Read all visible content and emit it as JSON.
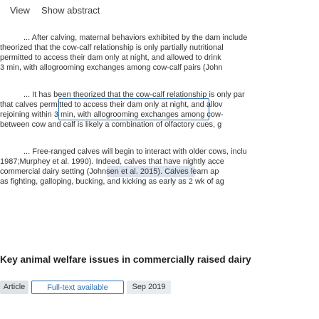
{
  "topbar": {
    "view_label": "View",
    "show_abstract_label": "Show abstract"
  },
  "paragraphs": [
    {
      "lines": [
        "... After calving, maternal behaviors exhibited by the dam include",
        "theorized that the cow-calf relationship is only partially nutritional",
        "permitted to access their dam only at night, and allowed to drink",
        "3 min, with allogrooming exchanges among cow-calf pairs (John"
      ]
    },
    {
      "lines": [
        "... It has been theorized that the cow-calf relationship is only par",
        "that calves permitted to access their dam only at night, and allov",
        "rejoining within 3 min, with allogrooming exchanges among cow-",
        "between cow and calf is likely a combination of olfactory cues, g"
      ]
    },
    {
      "lines": [
        "... Free-ranged calves will begin to interact with older cows, inclu",
        "1987;Murphey et al. 1990). Indeed, calves that have nightly acce",
        "commercial dairy setting (Johnsen et al. 2015). Calves learn ap",
        "as fighting, galloping, bucking, and kicking as early as 2 wk of ag"
      ]
    }
  ],
  "result": {
    "title": "Key animal welfare issues in commercially raised dairy",
    "type_label": "Article",
    "fulltext_label": "Full-text available",
    "date": "Sep 2019"
  },
  "colors": {
    "accent": "#2f6fb0",
    "highlight_pill": "#dde4ee",
    "tag_gray": "#dfe3e8"
  }
}
